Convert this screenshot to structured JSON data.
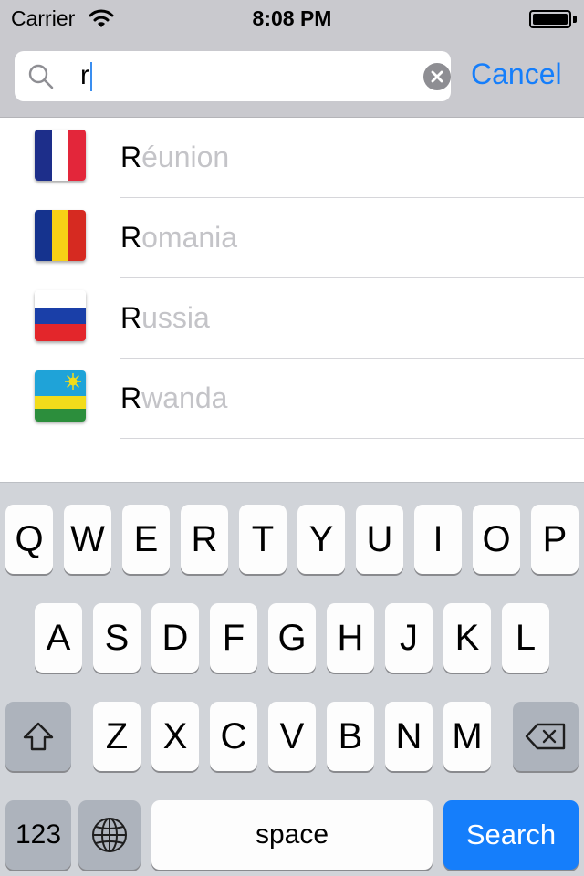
{
  "status_bar": {
    "carrier": "Carrier",
    "time": "8:08 PM"
  },
  "search": {
    "query": "r",
    "cancel_label": "Cancel"
  },
  "results": [
    {
      "match": "R",
      "rest": "éunion",
      "flag_icon": "france-flag-icon"
    },
    {
      "match": "R",
      "rest": "omania",
      "flag_icon": "romania-flag-icon"
    },
    {
      "match": "R",
      "rest": "ussia",
      "flag_icon": "russia-flag-icon"
    },
    {
      "match": "R",
      "rest": "wanda",
      "flag_icon": "rwanda-flag-icon"
    }
  ],
  "keyboard": {
    "row1": [
      "Q",
      "W",
      "E",
      "R",
      "T",
      "Y",
      "U",
      "I",
      "O",
      "P"
    ],
    "row2": [
      "A",
      "S",
      "D",
      "F",
      "G",
      "H",
      "J",
      "K",
      "L"
    ],
    "row3": [
      "Z",
      "X",
      "C",
      "V",
      "B",
      "N",
      "M"
    ],
    "numbers_label": "123",
    "space_label": "space",
    "search_label": "Search"
  },
  "colors": {
    "accent": "#157efb",
    "bar_background": "#c9c9ce",
    "keyboard_background": "#d1d4d9",
    "unmatched_text": "#c4c4c8"
  }
}
